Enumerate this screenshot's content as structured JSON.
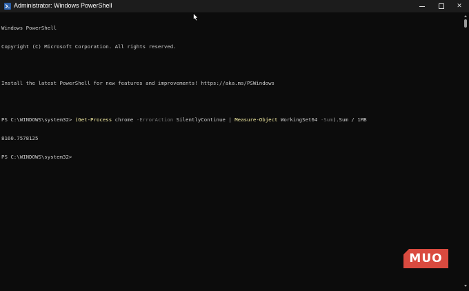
{
  "window": {
    "title": "Administrator: Windows PowerShell",
    "icon": "powershell-icon"
  },
  "caption_buttons": {
    "minimize_icon": "minimize-icon",
    "maximize_icon": "maximize-icon",
    "close_icon": "close-icon",
    "close_glyph": "✕"
  },
  "console": {
    "header_line1": "Windows PowerShell",
    "header_line2": "Copyright (C) Microsoft Corporation. All rights reserved.",
    "header_line4": "Install the latest PowerShell for new features and improvements! https://aka.ms/PSWindows",
    "prompt1": "PS C:\\WINDOWS\\system32> ",
    "cmd_part1": "(Get-Process",
    "cmd_part2": " chrome ",
    "cmd_part3": "-ErrorAction",
    "cmd_part4": " SilentlyContinue ",
    "cmd_part5": "|",
    "cmd_part6": " Measure-Object",
    "cmd_part7": " WorkingSet64 ",
    "cmd_part8": "-Sum",
    "cmd_part9": ").Sum / 1MB",
    "output1": "8160.7578125",
    "prompt2": "PS C:\\WINDOWS\\system32>"
  },
  "watermark": {
    "text": "MUO"
  },
  "colors": {
    "background": "#0c0c0c",
    "text": "#cccccc",
    "keyword": "#f9f1a5",
    "parameter": "#767676",
    "titlebar": "#1c1c1c",
    "watermark": "#d94a3f"
  }
}
